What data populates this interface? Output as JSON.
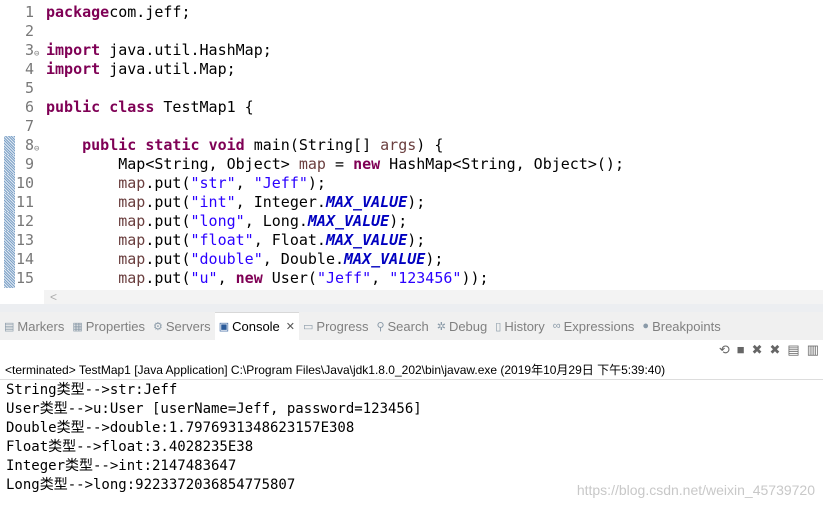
{
  "editor": {
    "lines": [
      {
        "n": "1",
        "t": [
          [
            "kw",
            "package"
          ],
          [
            "",
            "com.jeff;"
          ]
        ]
      },
      {
        "n": "2",
        "t": []
      },
      {
        "n": "3",
        "fold": true,
        "t": [
          [
            "kw",
            "import"
          ],
          [
            "",
            " java.util.HashMap;"
          ]
        ]
      },
      {
        "n": "4",
        "t": [
          [
            "kw",
            "import"
          ],
          [
            "",
            " java.util.Map;"
          ]
        ]
      },
      {
        "n": "5",
        "t": []
      },
      {
        "n": "6",
        "t": [
          [
            "kw",
            "public"
          ],
          [
            "",
            " "
          ],
          [
            "kw",
            "class"
          ],
          [
            "",
            " TestMap1 {"
          ]
        ]
      },
      {
        "n": "7",
        "t": []
      },
      {
        "n": "8",
        "fold": true,
        "mark": true,
        "t": [
          [
            "",
            "    "
          ],
          [
            "kw",
            "public"
          ],
          [
            "",
            " "
          ],
          [
            "kw",
            "static"
          ],
          [
            "",
            " "
          ],
          [
            "kw",
            "void"
          ],
          [
            "",
            " main(String[] "
          ],
          [
            "var",
            "args"
          ],
          [
            "",
            ") {"
          ]
        ]
      },
      {
        "n": "9",
        "mark": true,
        "t": [
          [
            "",
            "        Map<String, Object> "
          ],
          [
            "var",
            "map"
          ],
          [
            "",
            " = "
          ],
          [
            "kw",
            "new"
          ],
          [
            "",
            " HashMap<String, Object>();"
          ]
        ]
      },
      {
        "n": "10",
        "mark": true,
        "t": [
          [
            "",
            "        "
          ],
          [
            "var",
            "map"
          ],
          [
            "",
            ".put("
          ],
          [
            "str",
            "\"str\""
          ],
          [
            "",
            ", "
          ],
          [
            "str",
            "\"Jeff\""
          ],
          [
            "",
            ");"
          ]
        ]
      },
      {
        "n": "11",
        "mark": true,
        "t": [
          [
            "",
            "        "
          ],
          [
            "var",
            "map"
          ],
          [
            "",
            ".put("
          ],
          [
            "str",
            "\"int\""
          ],
          [
            "",
            ", Integer."
          ],
          [
            "fld",
            "MAX_VALUE"
          ],
          [
            "",
            ");"
          ]
        ]
      },
      {
        "n": "12",
        "mark": true,
        "t": [
          [
            "",
            "        "
          ],
          [
            "var",
            "map"
          ],
          [
            "",
            ".put("
          ],
          [
            "str",
            "\"long\""
          ],
          [
            "",
            ", Long."
          ],
          [
            "fld",
            "MAX_VALUE"
          ],
          [
            "",
            ");"
          ]
        ]
      },
      {
        "n": "13",
        "mark": true,
        "t": [
          [
            "",
            "        "
          ],
          [
            "var",
            "map"
          ],
          [
            "",
            ".put("
          ],
          [
            "str",
            "\"float\""
          ],
          [
            "",
            ", Float."
          ],
          [
            "fld",
            "MAX_VALUE"
          ],
          [
            "",
            ");"
          ]
        ]
      },
      {
        "n": "14",
        "mark": true,
        "t": [
          [
            "",
            "        "
          ],
          [
            "var",
            "map"
          ],
          [
            "",
            ".put("
          ],
          [
            "str",
            "\"double\""
          ],
          [
            "",
            ", Double."
          ],
          [
            "fld",
            "MAX_VALUE"
          ],
          [
            "",
            ");"
          ]
        ]
      },
      {
        "n": "15",
        "mark": true,
        "t": [
          [
            "",
            "        "
          ],
          [
            "var",
            "map"
          ],
          [
            "",
            ".put("
          ],
          [
            "str",
            "\"u\""
          ],
          [
            "",
            ", "
          ],
          [
            "kw",
            "new"
          ],
          [
            "",
            " User("
          ],
          [
            "str",
            "\"Jeff\""
          ],
          [
            "",
            ", "
          ],
          [
            "str",
            "\"123456\""
          ],
          [
            "",
            "));"
          ]
        ]
      }
    ]
  },
  "scroll_arrow": "<",
  "tabs": [
    {
      "label": "Markers",
      "icon": "markers-icon",
      "glyph": "▤"
    },
    {
      "label": "Properties",
      "icon": "properties-icon",
      "glyph": "▦"
    },
    {
      "label": "Servers",
      "icon": "servers-icon",
      "glyph": "⚙"
    },
    {
      "label": "Console",
      "icon": "console-icon",
      "glyph": "▣",
      "active": true,
      "close": "✕"
    },
    {
      "label": "Progress",
      "icon": "progress-icon",
      "glyph": "▭"
    },
    {
      "label": "Search",
      "icon": "search-icon",
      "glyph": "⚲"
    },
    {
      "label": "Debug",
      "icon": "debug-icon",
      "glyph": "✲"
    },
    {
      "label": "History",
      "icon": "history-icon",
      "glyph": "▯"
    },
    {
      "label": "Expressions",
      "icon": "expressions-icon",
      "glyph": "∞"
    },
    {
      "label": "Breakpoints",
      "icon": "breakpoints-icon",
      "glyph": "●"
    }
  ],
  "console_toolbar": [
    {
      "icon": "relaunch-icon",
      "glyph": "⟲"
    },
    {
      "icon": "terminate-icon",
      "glyph": "■"
    },
    {
      "icon": "remove-launch-icon",
      "glyph": "✖"
    },
    {
      "icon": "remove-all-icon",
      "glyph": "✖"
    },
    {
      "icon": "clear-console-icon",
      "glyph": "▤"
    },
    {
      "icon": "scroll-lock-icon",
      "glyph": "▥"
    }
  ],
  "console": {
    "status": "<terminated> TestMap1 [Java Application] C:\\Program Files\\Java\\jdk1.8.0_202\\bin\\javaw.exe (2019年10月29日 下午5:39:40)",
    "output": [
      "String类型-->str:Jeff",
      "User类型-->u:User [userName=Jeff, password=123456]",
      "Double类型-->double:1.7976931348623157E308",
      "Float类型-->float:3.4028235E38",
      "Integer类型-->int:2147483647",
      "Long类型-->long:9223372036854775807"
    ]
  },
  "watermark": "https://blog.csdn.net/weixin_45739720"
}
